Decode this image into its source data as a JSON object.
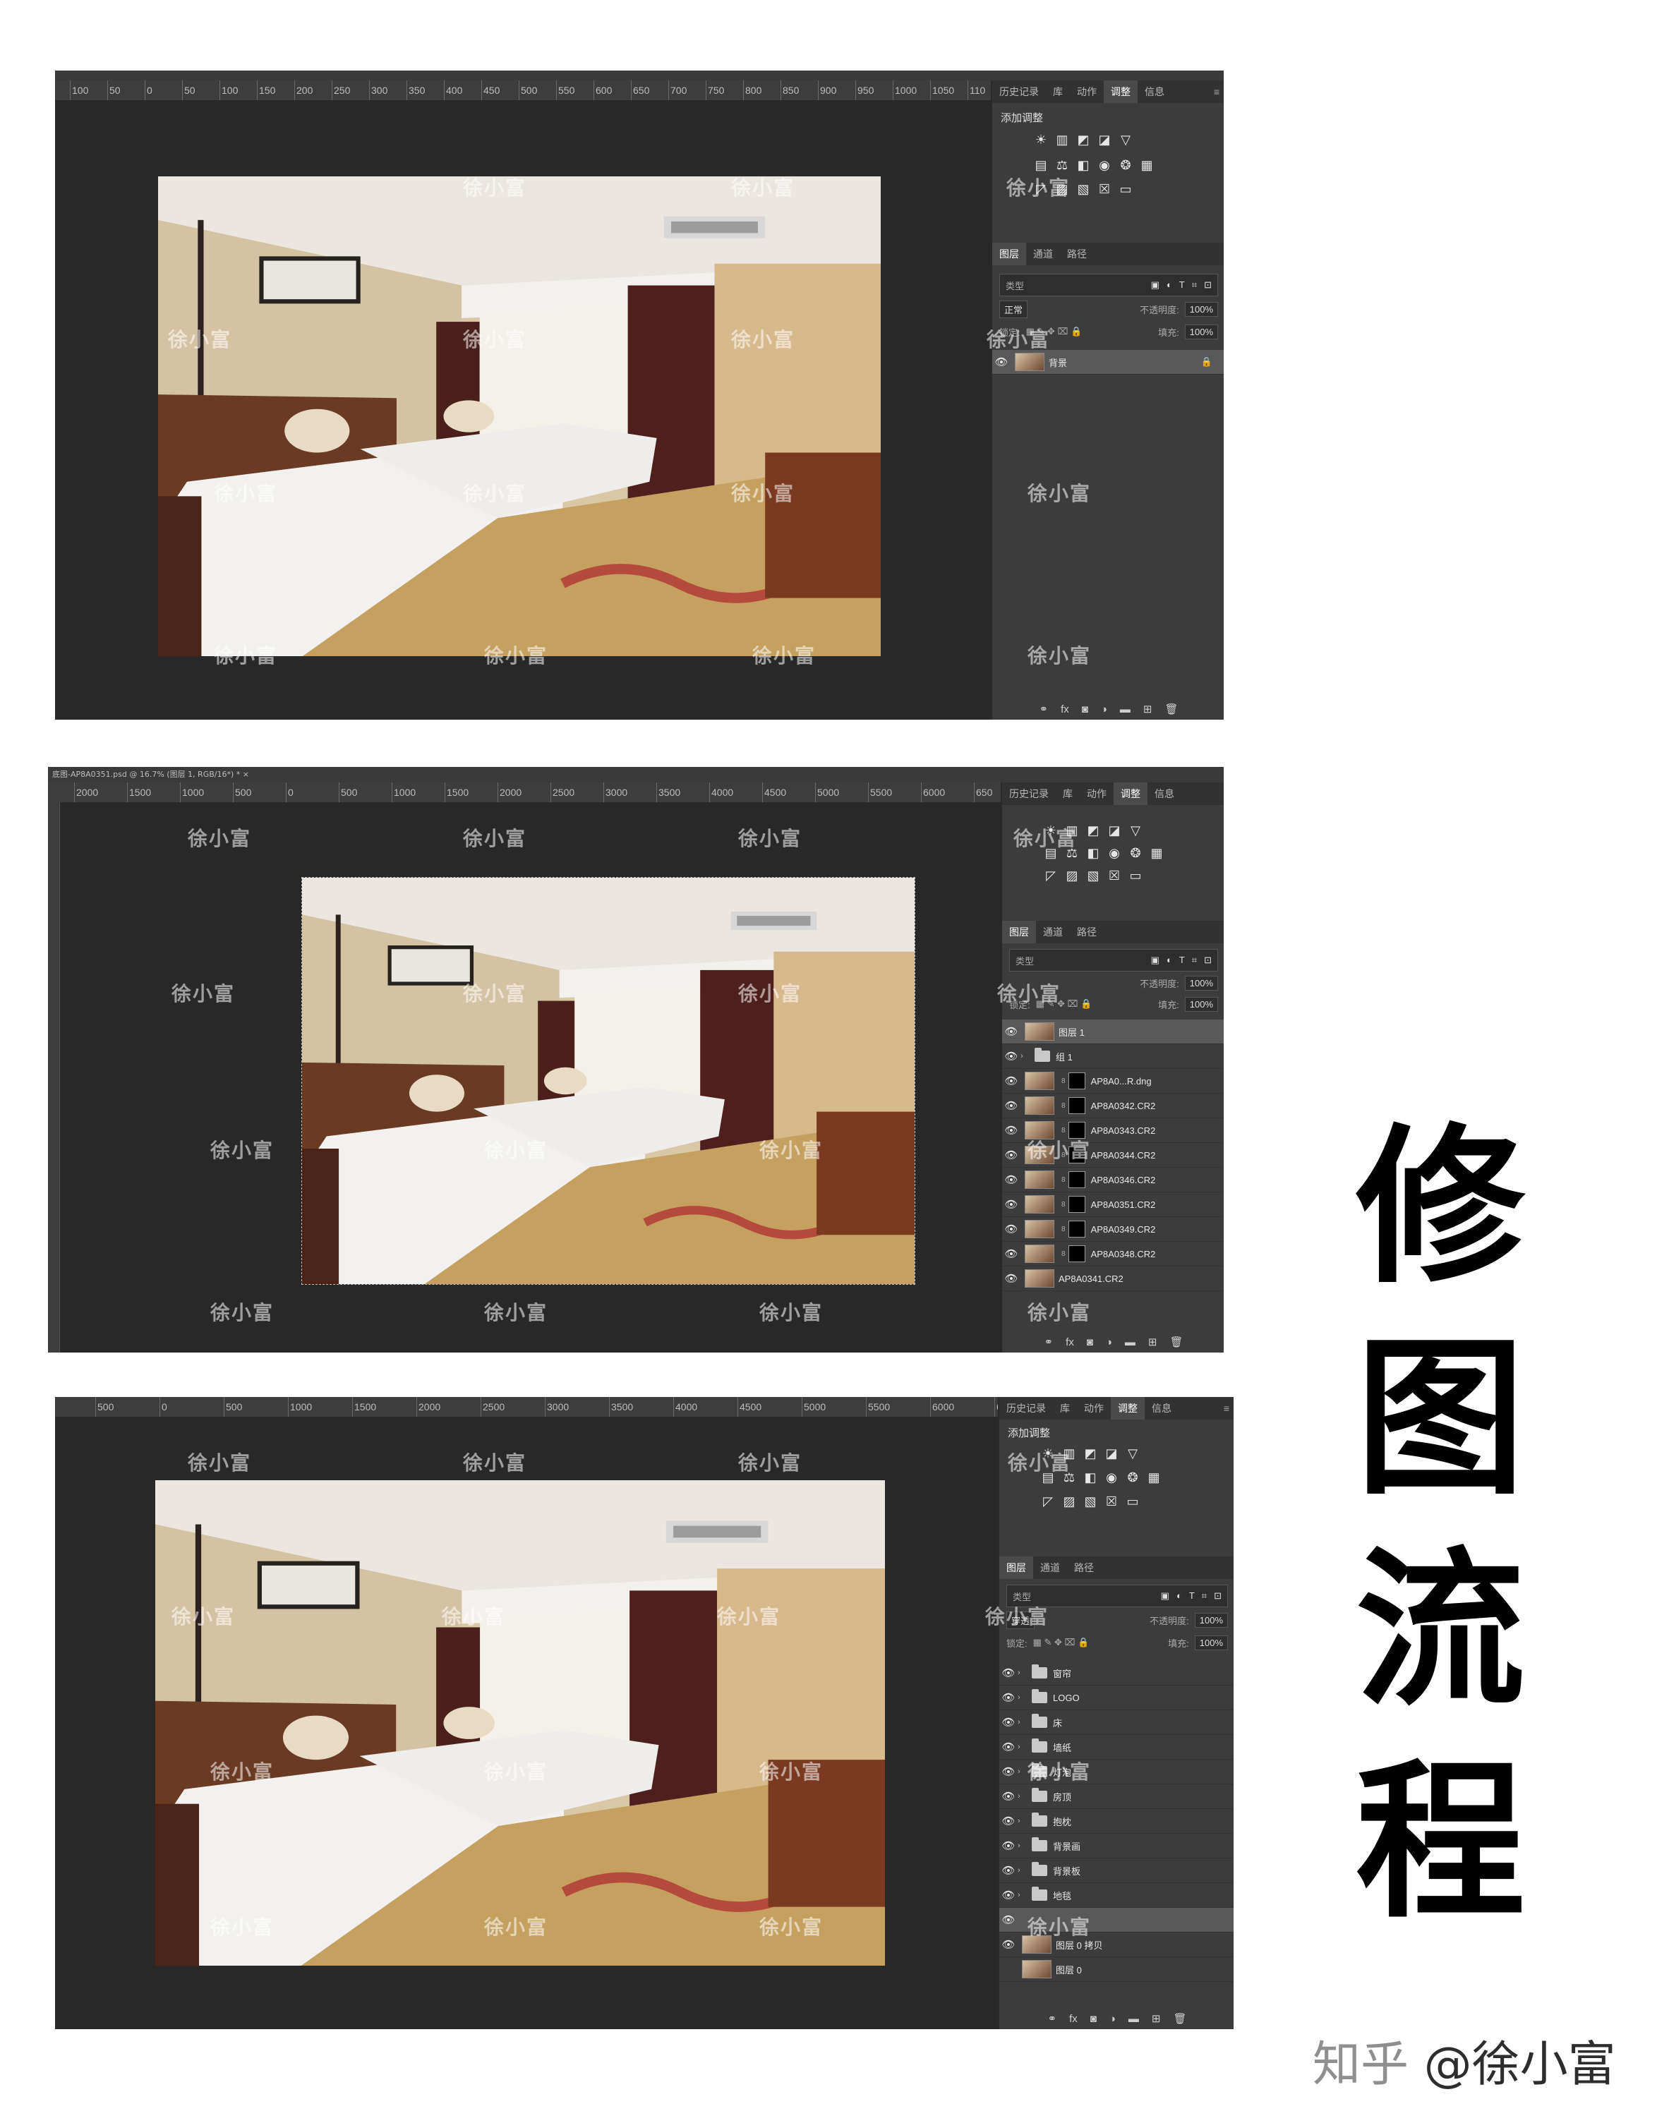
{
  "watermark": "徐小富",
  "title_chars": [
    "修",
    "图",
    "流",
    "程"
  ],
  "signature": {
    "platform": "知乎",
    "author": "@徐小富"
  },
  "panel_common": {
    "tabs": [
      "历史记录",
      "库",
      "动作",
      "调整",
      "信息"
    ],
    "add_adjustment": "添加调整",
    "layer_tabs": [
      "图层",
      "通道",
      "路径"
    ],
    "search_kind": "类型",
    "opacity_label": "不透明度:",
    "opacity_value": "100%",
    "lock_label": "锁定:",
    "fill_label": "填充:",
    "fill_value": "100%"
  },
  "screen1": {
    "doc_tab": "",
    "ruler": [
      "100",
      "50",
      "0",
      "50",
      "100",
      "150",
      "200",
      "250",
      "300",
      "350",
      "400",
      "450",
      "500",
      "550",
      "600",
      "650",
      "700",
      "750",
      "800",
      "850",
      "900",
      "950",
      "1000",
      "1050",
      "110"
    ],
    "blend_mode": "正常",
    "layers": [
      {
        "name": "背景",
        "type": "image",
        "locked": true,
        "selected": true
      }
    ]
  },
  "screen2": {
    "doc_tab": "底图-AP8A0351.psd @ 16.7% (图层 1, RGB/16*) *",
    "ruler": [
      "2000",
      "1500",
      "1000",
      "500",
      "0",
      "500",
      "1000",
      "1500",
      "2000",
      "2500",
      "3000",
      "3500",
      "4000",
      "4500",
      "5000",
      "5500",
      "6000",
      "650"
    ],
    "layers": [
      {
        "name": "图层 1",
        "type": "image",
        "selected": true
      },
      {
        "name": "组 1",
        "type": "folder"
      },
      {
        "name": "AP8A0...R.dng",
        "type": "masked"
      },
      {
        "name": "AP8A0342.CR2",
        "type": "masked"
      },
      {
        "name": "AP8A0343.CR2",
        "type": "masked"
      },
      {
        "name": "AP8A0344.CR2",
        "type": "masked"
      },
      {
        "name": "AP8A0346.CR2",
        "type": "masked"
      },
      {
        "name": "AP8A0351.CR2",
        "type": "masked"
      },
      {
        "name": "AP8A0349.CR2",
        "type": "masked"
      },
      {
        "name": "AP8A0348.CR2",
        "type": "masked"
      },
      {
        "name": "AP8A0341.CR2",
        "type": "image"
      }
    ]
  },
  "screen3": {
    "ruler": [
      "500",
      "0",
      "500",
      "1000",
      "1500",
      "2000",
      "2500",
      "3000",
      "3500",
      "4000",
      "4500",
      "5000",
      "5500",
      "6000",
      "650"
    ],
    "blend_mode": "穿透",
    "layers": [
      {
        "name": "窗帘",
        "type": "folder"
      },
      {
        "name": "LOGO",
        "type": "folder"
      },
      {
        "name": "床",
        "type": "folder"
      },
      {
        "name": "墙纸",
        "type": "folder"
      },
      {
        "name": "灯泡",
        "type": "folder"
      },
      {
        "name": "房顶",
        "type": "folder"
      },
      {
        "name": "抱枕",
        "type": "folder"
      },
      {
        "name": "背景画",
        "type": "folder"
      },
      {
        "name": "背景板",
        "type": "folder"
      },
      {
        "name": "地毯",
        "type": "folder"
      },
      {
        "name": "",
        "type": "blank",
        "selected": true
      },
      {
        "name": "图层 0 拷贝",
        "type": "image"
      },
      {
        "name": "图层 0",
        "type": "image",
        "hidden": true
      }
    ]
  }
}
